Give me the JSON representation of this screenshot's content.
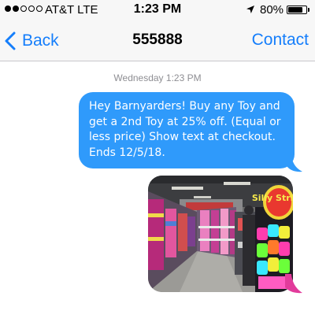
{
  "status_bar": {
    "carrier": "AT&T LTE",
    "time": "1:23 PM",
    "battery_percent": "80%",
    "battery_level": 0.8,
    "signal_bars_filled": 2,
    "signal_bars_total": 5
  },
  "nav": {
    "back_label": "Back",
    "title": "555888",
    "contact_label": "Contact"
  },
  "conversation": {
    "timestamp": "Wednesday 1:23 PM",
    "messages": [
      {
        "type": "text",
        "direction": "outgoing",
        "text": "Hey Barnyarders! Buy any Toy and get a 2nd Toy at 25% off. (Equal or less price) Show text at checkout. Ends 12/5/18."
      },
      {
        "type": "image",
        "direction": "outgoing",
        "sign_text": "Silly String"
      }
    ]
  },
  "colors": {
    "accent_blue": "#157efb",
    "bubble_blue": "#2f9afb",
    "bar_background": "#f7f7f7"
  }
}
